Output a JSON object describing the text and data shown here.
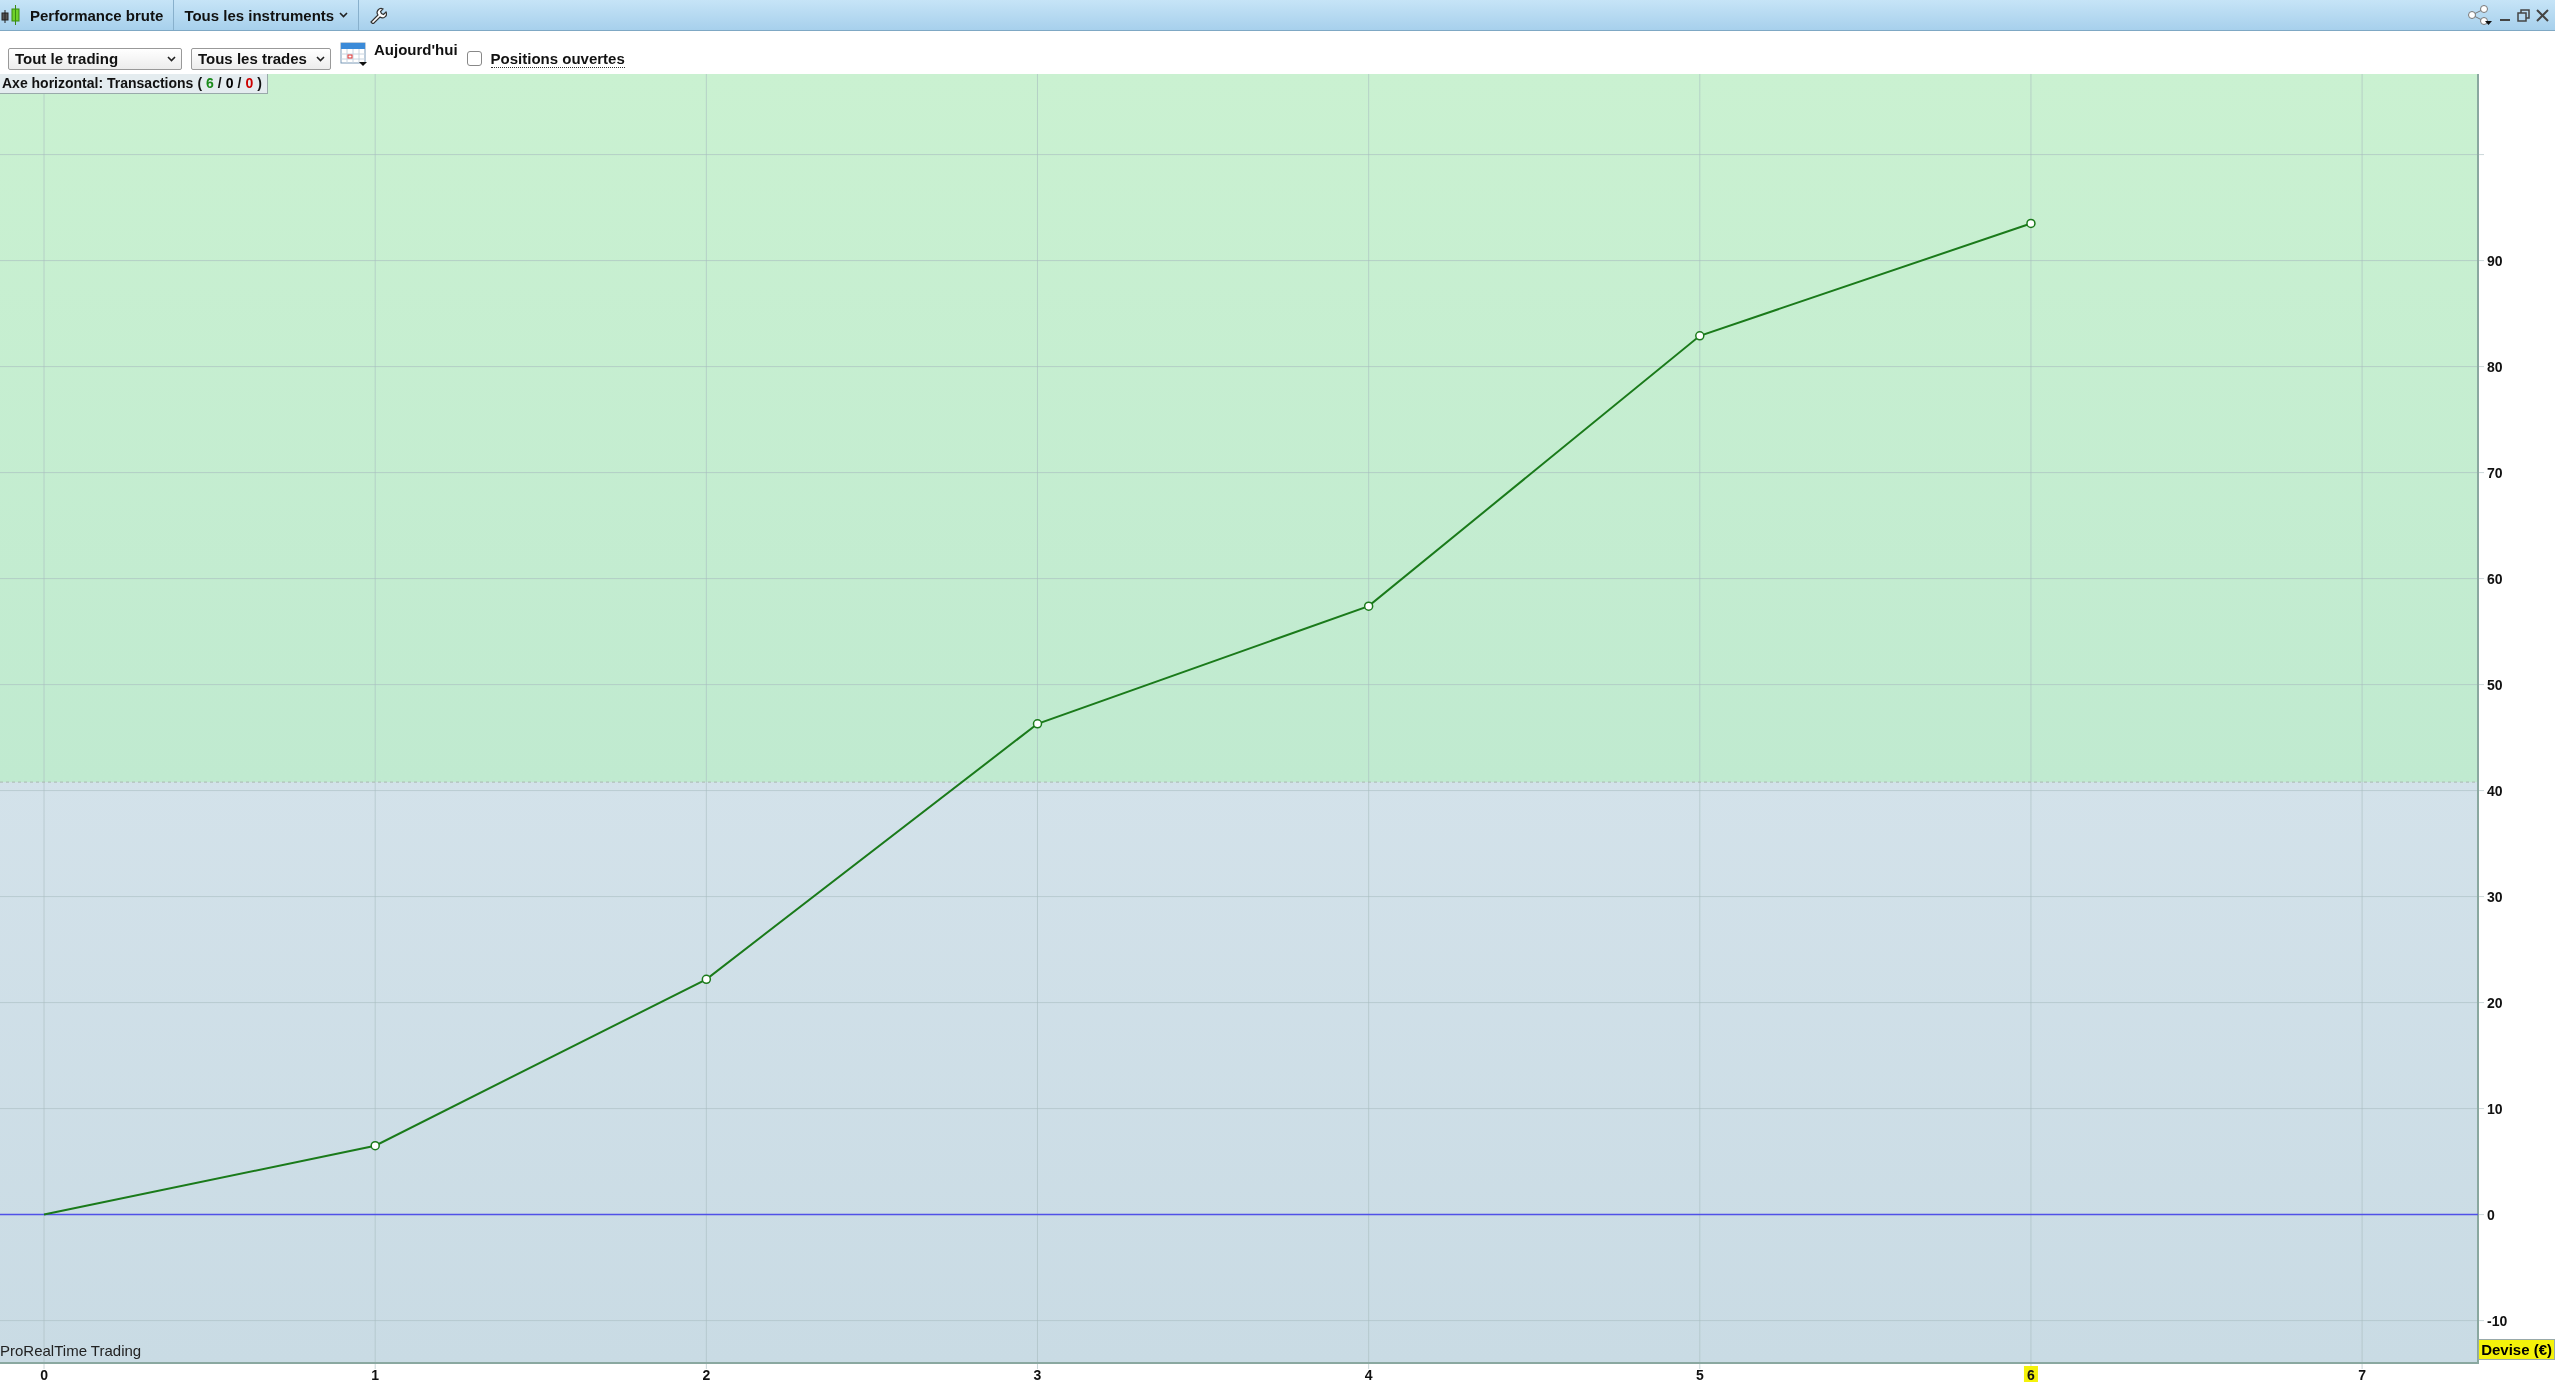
{
  "title_bar": {
    "title": "Performance brute",
    "instruments": "Tous les instruments"
  },
  "toolbar": {
    "scope": "Tout le trading",
    "trades": "Tous les trades",
    "date": "Aujourd'hui",
    "open_positions": {
      "label": "Positions ouvertes",
      "checked": false
    }
  },
  "axis_label": {
    "text": "Axe horizontal: Transactions",
    "open": "(",
    "close": ")",
    "separator": "/",
    "counts": [
      {
        "value": "6",
        "color": "#1a8a1a"
      },
      {
        "value": "0",
        "color": "#000000"
      },
      {
        "value": "0",
        "color": "#cc0000"
      }
    ]
  },
  "watermark": "ProRealTime Trading",
  "currency": "Devise (€)",
  "chart_data": {
    "type": "line",
    "x": [
      0,
      1,
      2,
      3,
      4,
      5,
      6
    ],
    "series": [
      {
        "color": "#1a7a1a",
        "marker": "circle",
        "values": [
          0,
          6.5,
          22.2,
          46.3,
          57.4,
          82.9,
          93.5
        ]
      }
    ],
    "xlim": [
      -0.133,
      7.35
    ],
    "ylim": [
      -14,
      107.6
    ],
    "grid": true,
    "xticks": [
      0,
      1,
      2,
      3,
      4,
      5,
      7
    ],
    "yticks": [
      -10,
      0,
      10,
      20,
      30,
      40,
      50,
      60,
      70,
      80,
      90
    ],
    "bands": [
      {
        "axis": "y",
        "from": 40.8,
        "to": 107.6,
        "color": "#c0ead0"
      }
    ],
    "ref_lines": [
      {
        "axis": "y",
        "value": 40.8,
        "color": "#aab8b0"
      },
      {
        "axis": "y",
        "value": 0,
        "color": "#5050e8"
      }
    ],
    "annotations": [
      {
        "x": 6,
        "text": "6"
      }
    ]
  }
}
